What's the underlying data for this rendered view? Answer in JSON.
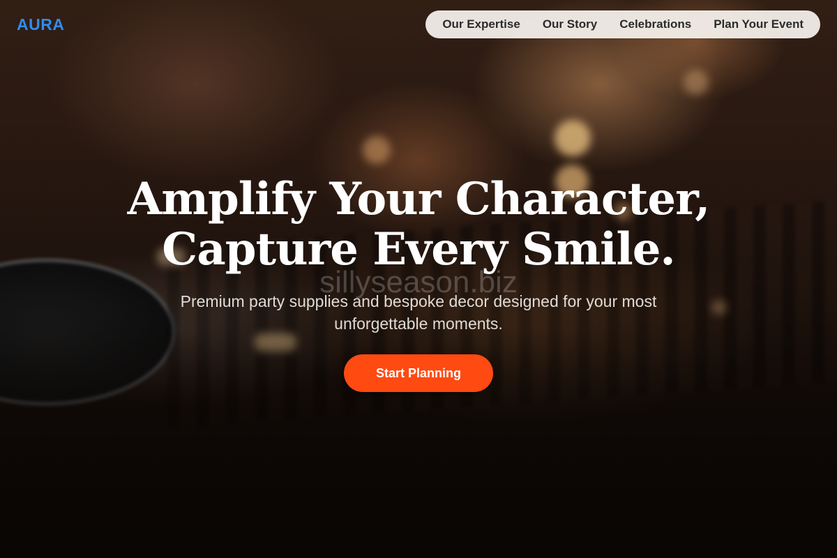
{
  "brand": {
    "logo_text": "AURA",
    "logo_color": "#2f8cf0"
  },
  "nav": {
    "items": [
      {
        "label": "Our Expertise"
      },
      {
        "label": "Our Story"
      },
      {
        "label": "Celebrations"
      },
      {
        "label": "Plan Your Event"
      }
    ]
  },
  "hero": {
    "title_line1": "Amplify Your Character,",
    "title_line2": "Capture Every Smile.",
    "subtitle": "Premium party supplies and bespoke decor designed for your most unforgettable moments.",
    "cta_label": "Start Planning",
    "cta_color": "#ff4a12",
    "watermark": "sillyseason.biz"
  }
}
